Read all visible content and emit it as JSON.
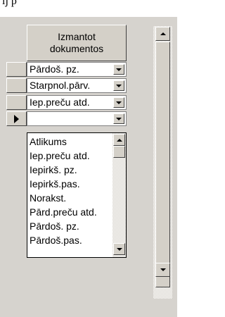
{
  "caption": "ij p",
  "grid": {
    "column_header": "Izmantot dokumentos",
    "rows": [
      {
        "value": "Pārdoš. pz."
      },
      {
        "value": "Starpnol.pārv."
      },
      {
        "value": "Iep.preču atd."
      },
      {
        "value": ""
      }
    ],
    "current_row_index": 3
  },
  "dropdown_list": {
    "items": [
      "Atlikums",
      "Iep.preču atd.",
      "Iepirkš. pz.",
      "Iepirkš.pas.",
      "Norakst.",
      "Pārd.preču atd.",
      "Pārdoš. pz.",
      "Pārdoš.pas."
    ]
  },
  "colors": {
    "panel_bg": "#d6d3ce",
    "button_face": "#d4d0c8"
  }
}
